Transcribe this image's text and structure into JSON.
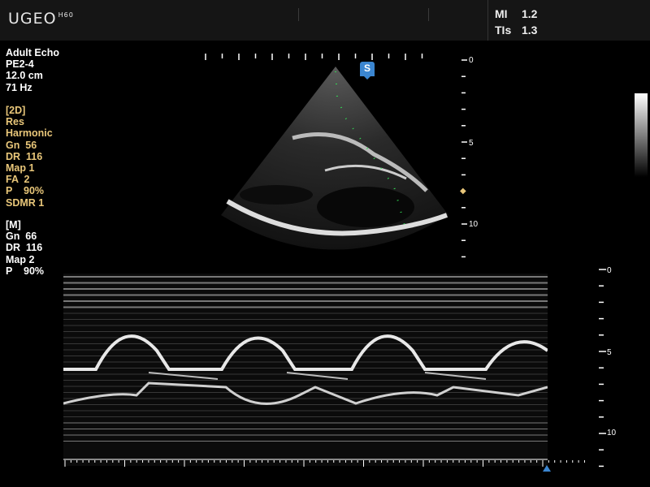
{
  "header": {
    "logo": "UGEO",
    "logo_sup": "H60",
    "mi_label": "MI",
    "mi_value": "1.2",
    "tis_label": "TIs",
    "tis_value": "1.3"
  },
  "left_panel": {
    "general": [
      "Adult Echo",
      "PE2-4",
      "12.0 cm",
      "71 Hz"
    ],
    "mode_2d": [
      "[2D]",
      "Res",
      "Harmonic",
      "Gn  56",
      "DR  116",
      "Map 1",
      "FA  2",
      "P    90%",
      "SDMR 1"
    ],
    "mode_m": [
      "[M]",
      "Gn  66",
      "DR  116",
      "Map 2",
      "P    90%"
    ]
  },
  "depth_scale_2d": {
    "labels": [
      "0",
      "5",
      "10"
    ]
  },
  "depth_scale_m": {
    "labels": [
      "0",
      "5",
      "10"
    ]
  },
  "sector_badge": "S",
  "colors": {
    "accent": "#3b86d1",
    "param_text": "#e9c77a",
    "focus_marker": "#e9c77a"
  },
  "icons": {
    "focus": "focus-marker-icon",
    "timeline": "timeline-cursor-icon"
  }
}
